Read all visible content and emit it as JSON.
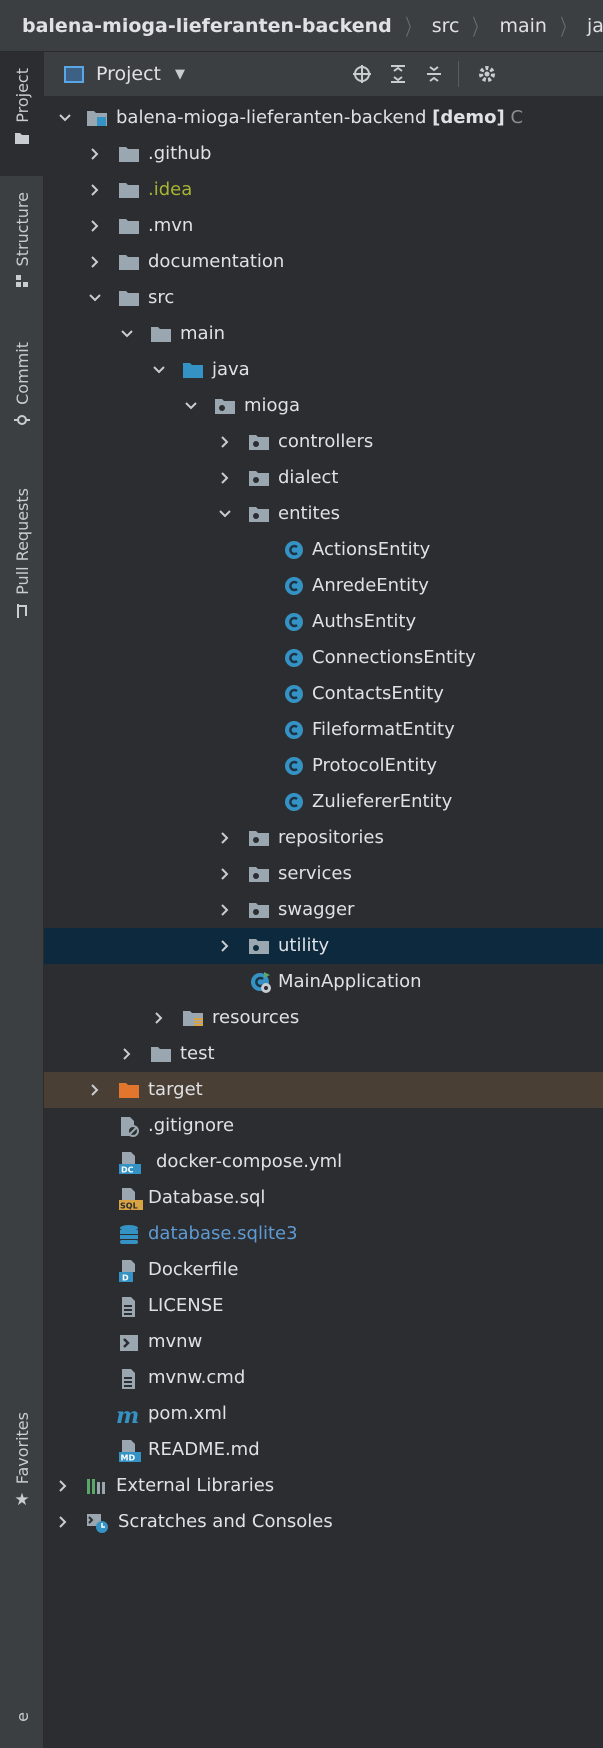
{
  "breadcrumb": [
    "balena-mioga-lieferanten-backend",
    "src",
    "main",
    "ja"
  ],
  "stripe": {
    "project": "Project",
    "structure": "Structure",
    "commit": "Commit",
    "pull_requests": "Pull Requests",
    "favorites": "Favorites",
    "bottom_partial": "e"
  },
  "panel": {
    "view_label": "Project"
  },
  "tree": {
    "root": {
      "name": "balena-mioga-lieferanten-backend",
      "tag": "[demo]",
      "tail": "C"
    },
    "github": ".github",
    "idea": ".idea",
    "mvn": ".mvn",
    "documentation": "documentation",
    "src": "src",
    "main": "main",
    "java": "java",
    "mioga": "mioga",
    "controllers": "controllers",
    "dialect": "dialect",
    "entites": "entites",
    "entities": [
      "ActionsEntity",
      "AnredeEntity",
      "AuthsEntity",
      "ConnectionsEntity",
      "ContactsEntity",
      "FileformatEntity",
      "ProtocolEntity",
      "ZuliefererEntity"
    ],
    "repositories": "repositories",
    "services": "services",
    "swagger": "swagger",
    "utility": "utility",
    "main_application": "MainApplication",
    "resources": "resources",
    "test": "test",
    "target": "target",
    "gitignore": ".gitignore",
    "docker_compose": "docker-compose.yml",
    "database_sql": "Database.sql",
    "database_sqlite": "database.sqlite3",
    "dockerfile": "Dockerfile",
    "license": "LICENSE",
    "mvnw": "mvnw",
    "mvnw_cmd": "mvnw.cmd",
    "pom": "pom.xml",
    "readme": "README.md",
    "external_libraries": "External Libraries",
    "scratches": "Scratches and Consoles"
  },
  "colors": {
    "folder": "#9aa7b0",
    "source_folder": "#3592c4",
    "excluded_folder": "#e2762c",
    "class_icon": "#3592c4",
    "idea_text": "#a8b533",
    "selection": "#0d293e"
  }
}
